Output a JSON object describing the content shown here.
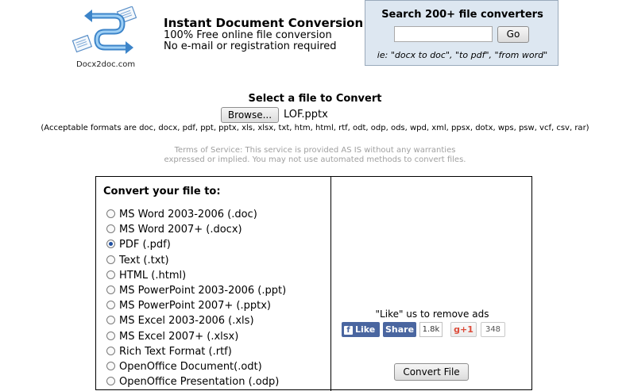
{
  "logo": {
    "text": "Docx2doc.com"
  },
  "header": {
    "title": "Instant Document Conversion",
    "line1": "100% Free online file conversion",
    "line2": "No e-mail or registration required"
  },
  "search": {
    "title": "Search 200+ file converters",
    "value": "",
    "go_label": "Go",
    "hint": "ie: \"docx to doc\", \"to pdf\", \"from word\""
  },
  "upload": {
    "title": "Select a file to Convert",
    "browse_label": "Browse...",
    "file_name": "LOF.pptx",
    "formats": "(Acceptable formats are doc, docx, pdf, ppt, pptx, xls, xlsx, txt, htm, html, rtf, odt, odp, ods, wpd, xml, ppsx, dotx, wps, psw, vcf, csv, rar)",
    "terms_line1": "Terms of Service: This service is provided AS IS without any warranties",
    "terms_line2": "expressed or implied. You may not use automated methods to convert files."
  },
  "convert": {
    "title": "Convert your file to:",
    "options": [
      {
        "label": "MS Word 2003-2006 (.doc)",
        "checked": false
      },
      {
        "label": "MS Word 2007+ (.docx)",
        "checked": false
      },
      {
        "label": "PDF (.pdf)",
        "checked": true
      },
      {
        "label": "Text (.txt)",
        "checked": false
      },
      {
        "label": "HTML (.html)",
        "checked": false
      },
      {
        "label": "MS PowerPoint 2003-2006 (.ppt)",
        "checked": false
      },
      {
        "label": "MS PowerPoint 2007+ (.pptx)",
        "checked": false
      },
      {
        "label": "MS Excel 2003-2006 (.xls)",
        "checked": false
      },
      {
        "label": "MS Excel 2007+ (.xlsx)",
        "checked": false
      },
      {
        "label": "Rich Text Format (.rtf)",
        "checked": false
      },
      {
        "label": "OpenOffice Document(.odt)",
        "checked": false
      },
      {
        "label": "OpenOffice Presentation (.odp)",
        "checked": false
      }
    ],
    "button_label": "Convert File"
  },
  "social": {
    "like_text": "\"Like\" us to remove ads",
    "fb_like_label": "Like",
    "fb_share_label": "Share",
    "fb_count": "1.8k",
    "gplus_label": "g+1",
    "gplus_count": "348"
  },
  "colors": {
    "search_bg": "#dde7f1",
    "facebook_blue": "#4a66a0",
    "gplus_red": "#dd4b39",
    "terms_gray": "#a0a0a0"
  }
}
